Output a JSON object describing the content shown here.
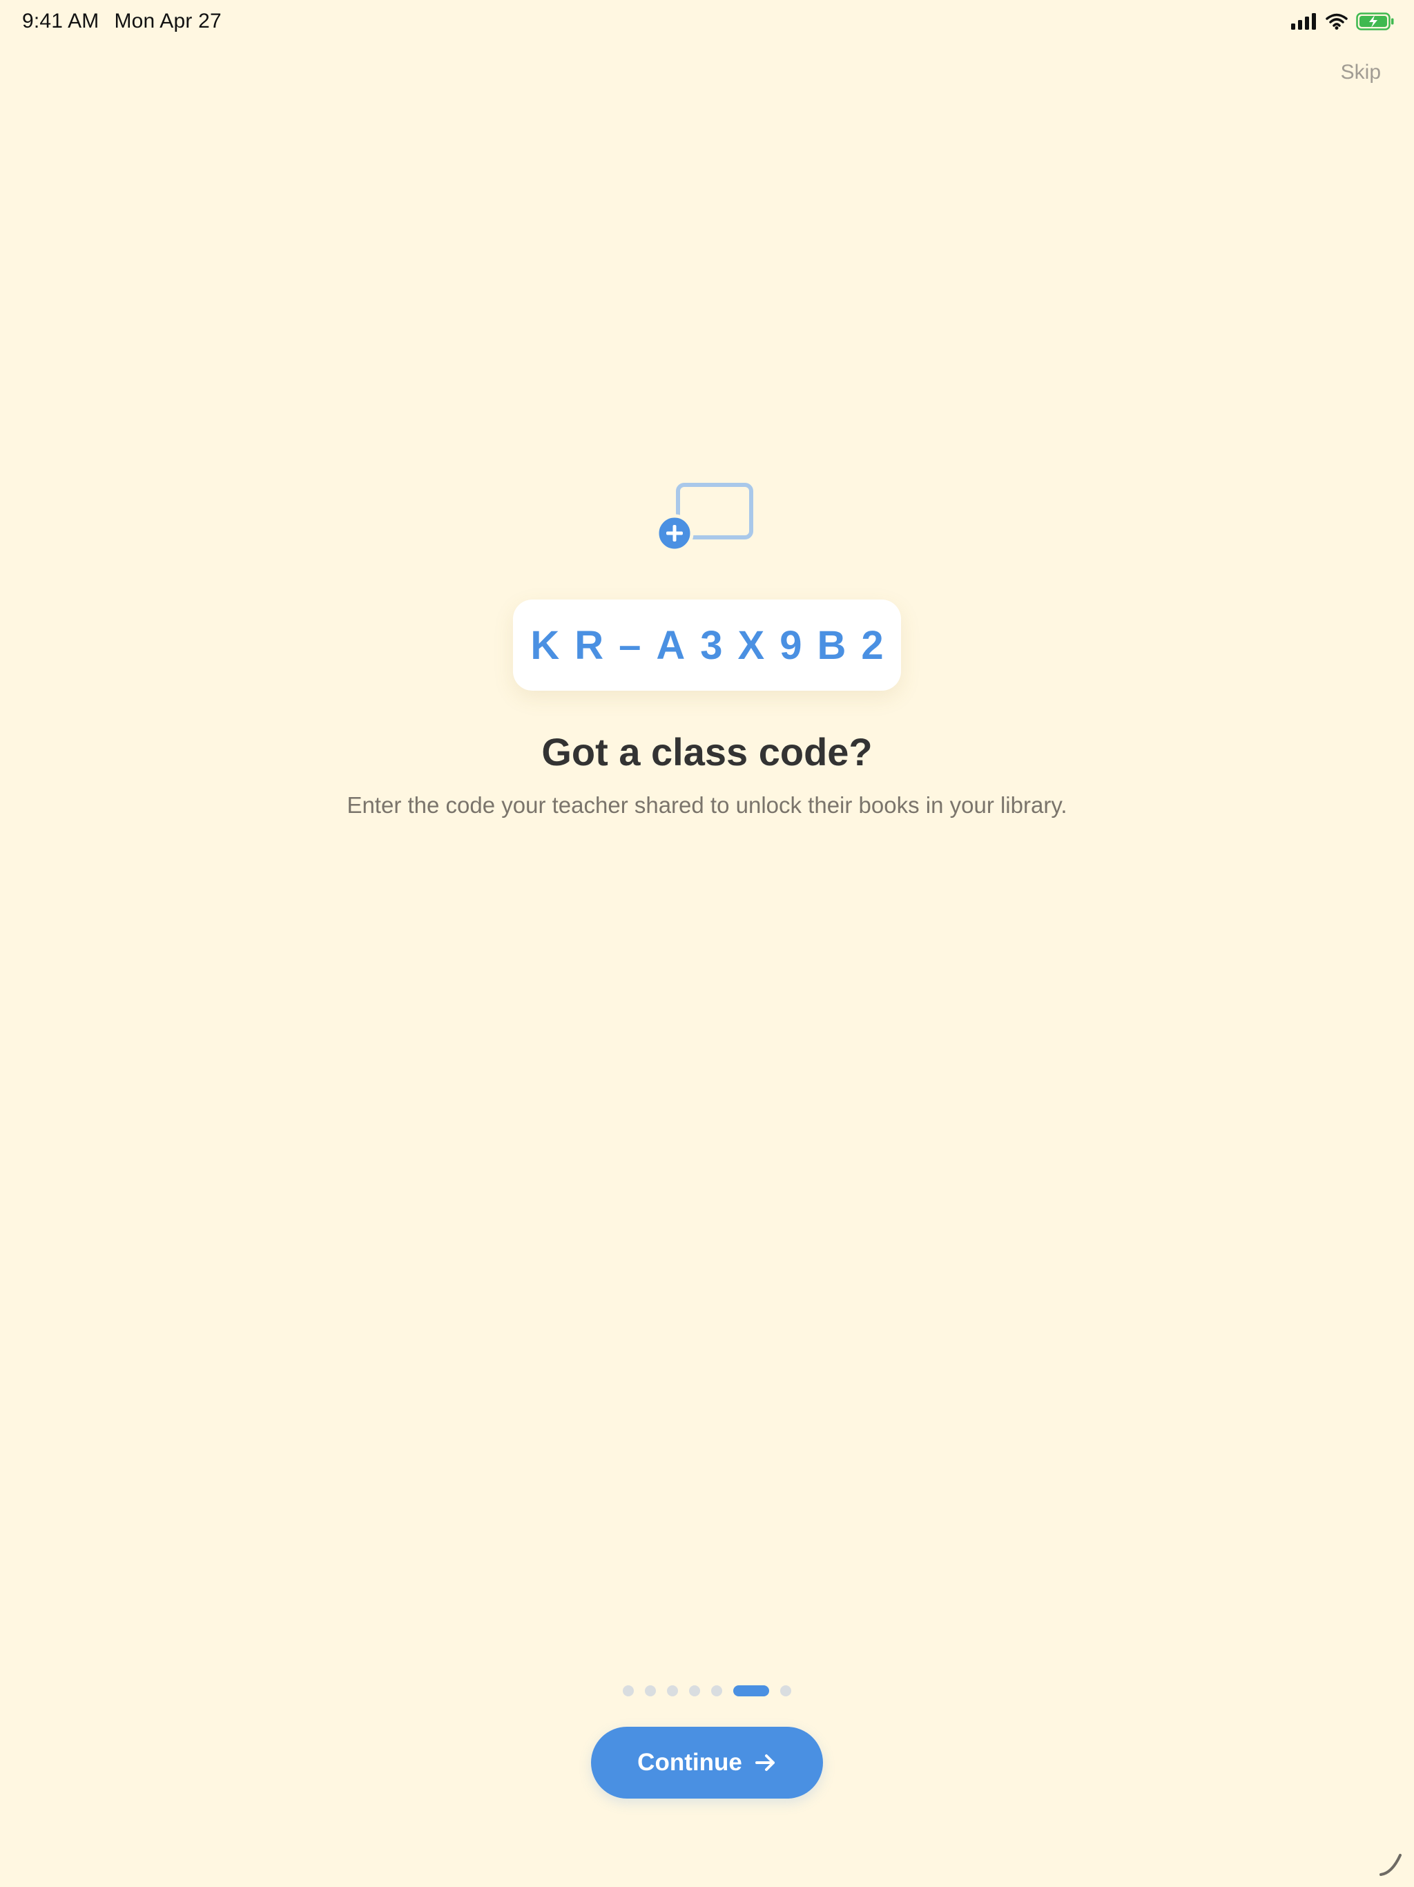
{
  "status_bar": {
    "time": "9:41 AM",
    "date": "Mon Apr 27",
    "icons": [
      "signal-icon",
      "wifi-icon",
      "battery-charging-icon"
    ]
  },
  "top": {
    "skip_label": "Skip"
  },
  "hero": {
    "icon": "add-class-icon",
    "code": "KR–A3X9B2",
    "title": "Got a class code?",
    "subtitle": "Enter the code your teacher shared to unlock their books in your library."
  },
  "pager": {
    "total": 7,
    "active_index": 5
  },
  "cta": {
    "label": "Continue",
    "icon": "arrow-right-icon"
  },
  "colors": {
    "background": "#FFF7E1",
    "accent": "#4A90E2",
    "title": "#333333",
    "subtitle": "#7A746B"
  }
}
